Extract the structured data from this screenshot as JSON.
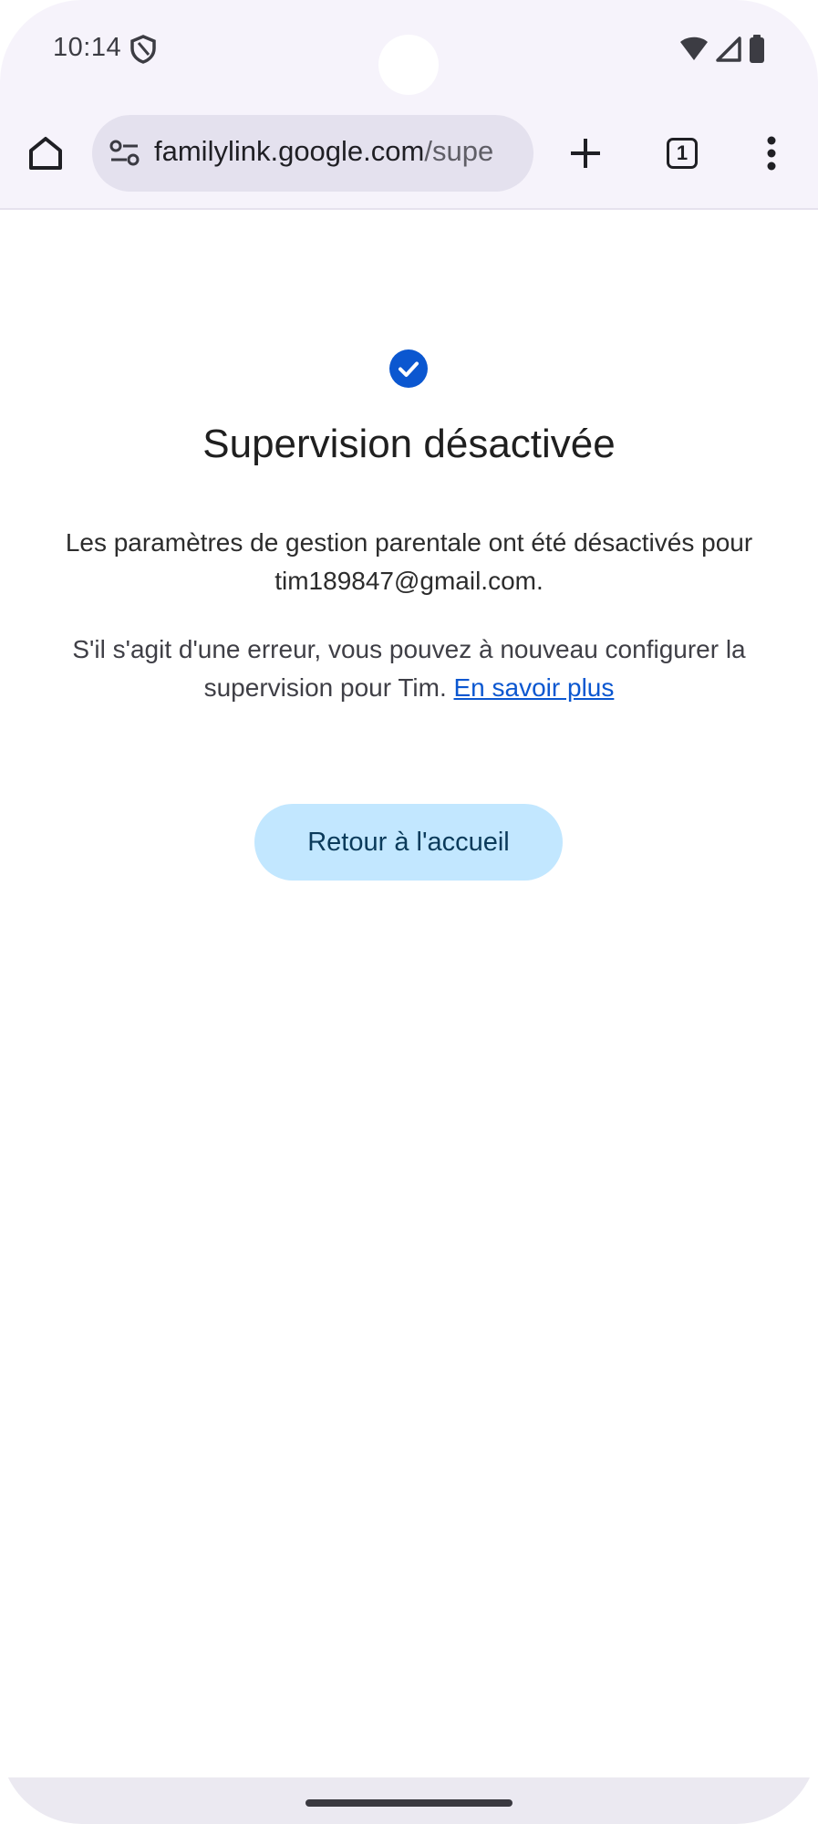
{
  "status_bar": {
    "time": "10:14",
    "icons": [
      "shield-icon",
      "wifi-icon",
      "cell-signal-icon",
      "battery-icon"
    ]
  },
  "browser": {
    "url_domain": "familylink.google.com",
    "url_path": "/supe",
    "tab_count": "1",
    "icons": [
      "home-icon",
      "site-settings-icon",
      "plus-icon",
      "tabs-icon",
      "more-vert-icon"
    ]
  },
  "page": {
    "title": "Supervision désactivée",
    "paragraph1": "Les paramètres de gestion parentale ont été désactivés pour tim189847@gmail.com.",
    "paragraph2_text": "S'il s'agit d'une erreur, vous pouvez à nouveau configurer la supervision pour Tim.",
    "learn_more_link": "En savoir plus",
    "return_button": "Retour à l'accueil"
  },
  "colors": {
    "accent_blue": "#0b57d0",
    "button_bg": "#c2e7ff",
    "chrome_bg": "#f6f3fb",
    "url_bar_bg": "#e4e1ee"
  }
}
